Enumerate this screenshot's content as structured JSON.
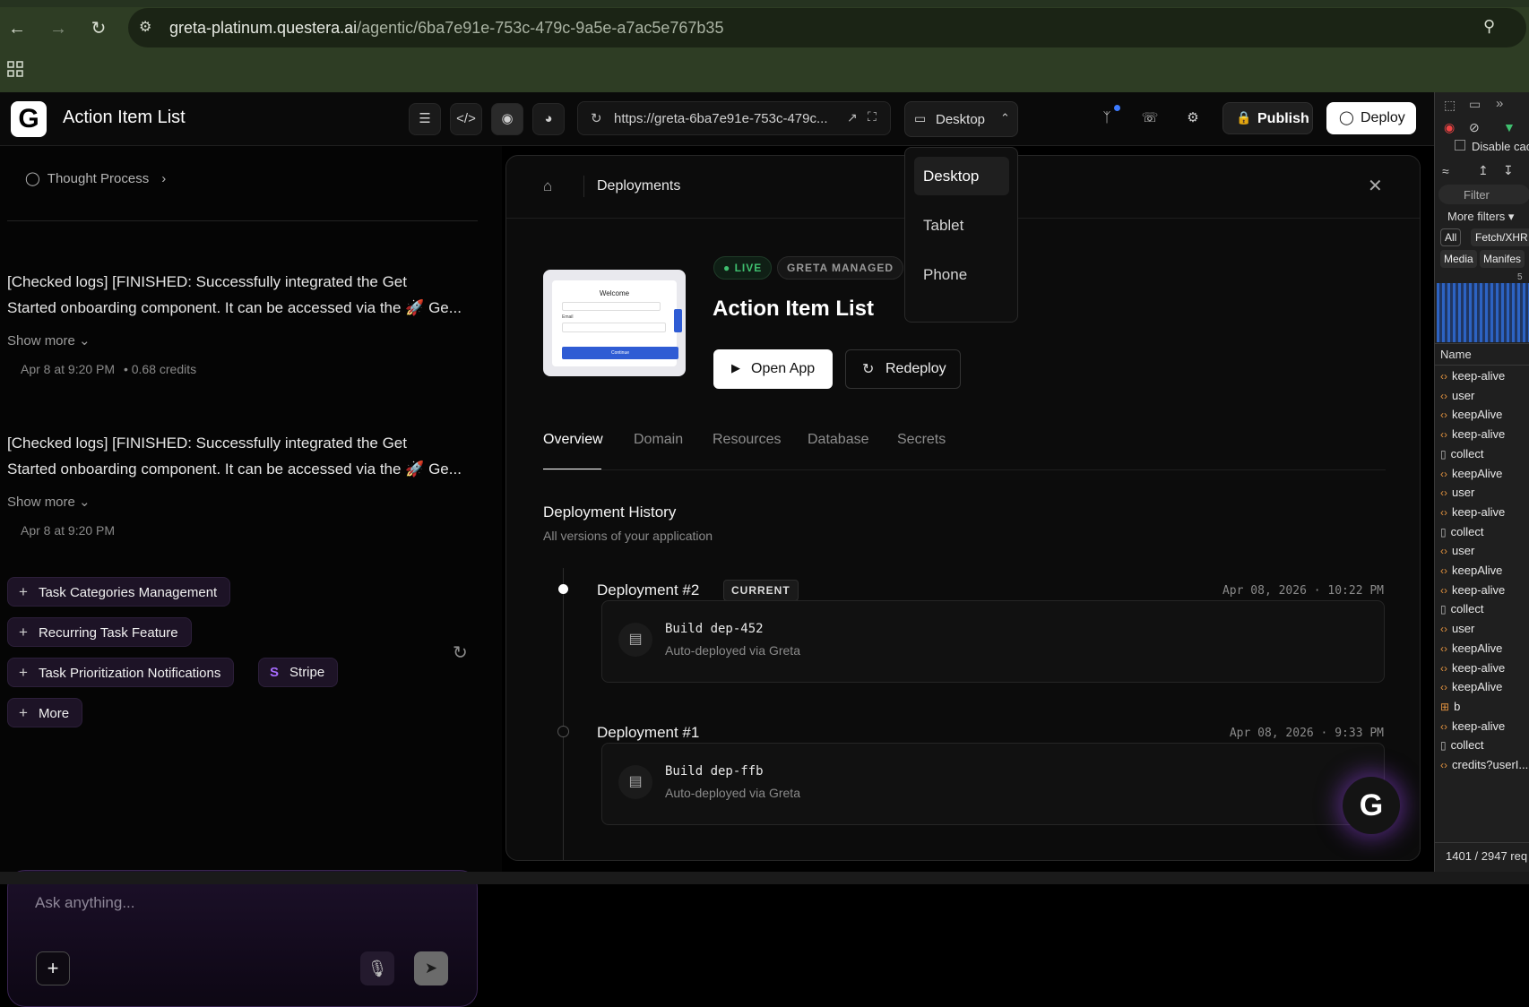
{
  "browser": {
    "url_host": "greta-platinum.questera.ai",
    "url_path": "/agentic/6ba7e91e-753c-479c-9a5e-a7ac5e767b35",
    "back_icon": "arrow-left-icon",
    "forward_icon": "arrow-right-icon",
    "reload_icon": "reload-icon"
  },
  "header": {
    "logo": "G",
    "title": "Action Item List",
    "preview_url": "https://greta-6ba7e91e-753c-479c...",
    "device_label": "Desktop",
    "publish_label": "Publish",
    "deploy_label": "Deploy"
  },
  "device_menu": {
    "options": [
      "Desktop",
      "Tablet",
      "Phone"
    ],
    "selected": "Desktop"
  },
  "left": {
    "thought_process": "Thought Process",
    "messages": [
      {
        "line1": "[Checked logs] [FINISHED: Successfully integrated the Get",
        "line2": "Started onboarding component. It can be accessed via the 🚀 Ge...",
        "show_more": "Show more",
        "meta": "Apr 8 at 9:20 PM",
        "credits": "• 0.68 credits"
      },
      {
        "line1": "[Checked logs] [FINISHED: Successfully integrated the Get",
        "line2": "Started onboarding component. It can be accessed via the 🚀 Ge...",
        "show_more": "Show more",
        "meta": "Apr 8 at 9:20 PM"
      }
    ],
    "suggestions": [
      "Task Categories Management",
      "Recurring Task Feature",
      "Task Prioritization Notifications",
      "Stripe",
      "More"
    ],
    "compose_placeholder": "Ask anything..."
  },
  "deployments": {
    "breadcrumb": "Deployments",
    "live_badge": "LIVE",
    "managed_badge": "GRETA MANAGED",
    "app_name": "Action Item List",
    "open_app": "Open App",
    "redeploy": "Redeploy",
    "thumb_title": "Welcome",
    "thumb_field_label": "Email",
    "thumb_button": "Continue",
    "tabs": [
      "Overview",
      "Domain",
      "Resources",
      "Database",
      "Secrets"
    ],
    "history_title": "Deployment History",
    "history_subtitle": "All versions of your application",
    "items": [
      {
        "name": "Deployment #2",
        "badge": "CURRENT",
        "time": "Apr 08, 2026 · 10:22 PM",
        "build": "Build dep-452",
        "source": "Auto-deployed via Greta"
      },
      {
        "name": "Deployment #1",
        "badge": "",
        "time": "Apr 08, 2026 · 9:33 PM",
        "build": "Build dep-ffb",
        "source": "Auto-deployed via Greta"
      }
    ]
  },
  "devtools": {
    "disable_cache": "Disable cac",
    "filter": "Filter",
    "more_filters": "More filters",
    "filter_all": "All",
    "filter_fetch": "Fetch/XHR",
    "filter_media": "Media",
    "filter_manifest": "Manifes",
    "timeline_tick": "5",
    "name_header": "Name",
    "requests": [
      {
        "name": "keep-alive",
        "type": "xhr"
      },
      {
        "name": "user",
        "type": "xhr"
      },
      {
        "name": "keepAlive",
        "type": "xhr"
      },
      {
        "name": "keep-alive",
        "type": "xhr"
      },
      {
        "name": "collect",
        "type": "doc"
      },
      {
        "name": "keepAlive",
        "type": "xhr"
      },
      {
        "name": "user",
        "type": "xhr"
      },
      {
        "name": "keep-alive",
        "type": "xhr"
      },
      {
        "name": "collect",
        "type": "doc"
      },
      {
        "name": "user",
        "type": "xhr"
      },
      {
        "name": "keepAlive",
        "type": "xhr"
      },
      {
        "name": "keep-alive",
        "type": "xhr"
      },
      {
        "name": "collect",
        "type": "doc"
      },
      {
        "name": "user",
        "type": "xhr"
      },
      {
        "name": "keepAlive",
        "type": "xhr"
      },
      {
        "name": "keep-alive",
        "type": "xhr"
      },
      {
        "name": "keepAlive",
        "type": "xhr"
      },
      {
        "name": "b",
        "type": "script"
      },
      {
        "name": "keep-alive",
        "type": "xhr"
      },
      {
        "name": "collect",
        "type": "doc"
      },
      {
        "name": "credits?userI...",
        "type": "xhr"
      }
    ],
    "status": "1401 / 2947 req"
  },
  "colors": {
    "live_green": "#3fbf6f",
    "primary_button_bg": "#ffffff",
    "chip_bg": "#1d1326",
    "browser_chrome": "#2e3d24",
    "devtools_warn": "#e0913f"
  }
}
